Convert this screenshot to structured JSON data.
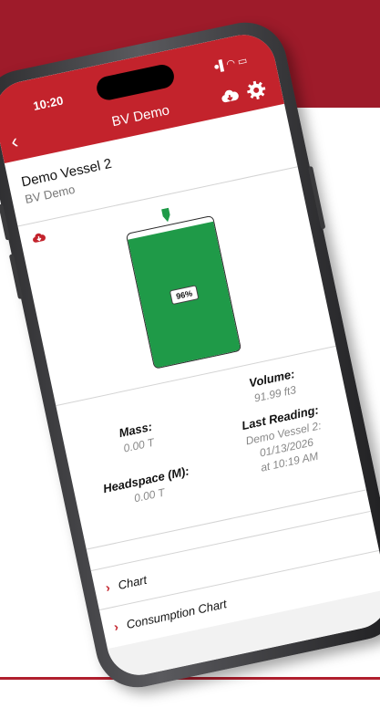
{
  "status": {
    "time": "10:20",
    "icons": "●▌◠ ▭"
  },
  "header": {
    "back_symbol": "‹",
    "title": "BV Demo"
  },
  "vessel": {
    "name": "Demo Vessel 2",
    "group": "BV Demo"
  },
  "tank": {
    "level_percent": 96,
    "label": "96%"
  },
  "stats": {
    "mass_label": "Mass:",
    "mass_value": "0.00 T",
    "headspace_label": "Headspace (M):",
    "headspace_value": "0.00 T",
    "volume_label": "Volume:",
    "volume_value": "91.99 ft3",
    "last_reading_label": "Last Reading:",
    "last_reading_line1": "Demo Vessel 2:",
    "last_reading_line2": "01/13/2026",
    "last_reading_line3": "at 10:19 AM"
  },
  "links": [
    {
      "label": "Chart"
    },
    {
      "label": "Consumption Chart"
    }
  ],
  "colors": {
    "brand": "#c3232c",
    "tank_fill": "#1f9a48",
    "banner": "#9e1b2a"
  },
  "icons": {
    "cloud": "cloud-download-icon",
    "gear": "gear-icon",
    "back": "chevron-left-icon",
    "marker": "level-marker-icon"
  }
}
